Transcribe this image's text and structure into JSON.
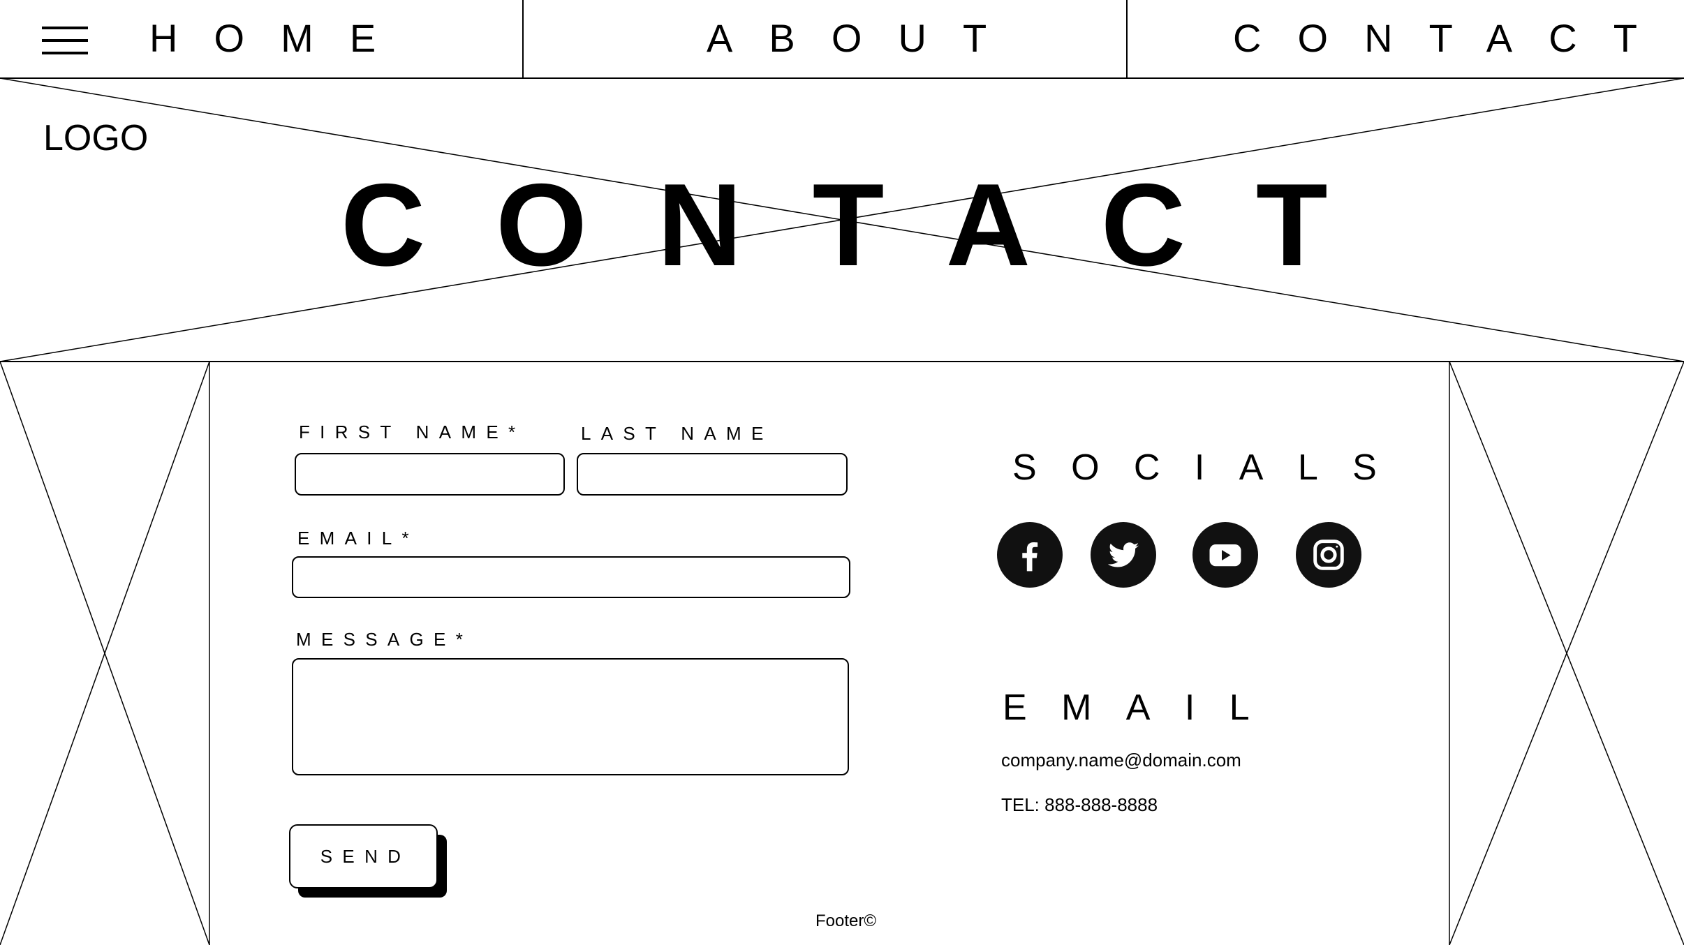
{
  "nav": {
    "menu_icon": "hamburger-icon",
    "links": [
      "HOME",
      "ABOUT",
      "CONTACT"
    ]
  },
  "header": {
    "logo": "LOGO",
    "title": "CONTACT"
  },
  "form": {
    "first_name_label": "FIRST NAME*",
    "last_name_label": "LAST NAME",
    "email_label": "EMAIL*",
    "message_label": "MESSAGE*",
    "first_name_value": "",
    "last_name_value": "",
    "email_value": "",
    "message_value": "",
    "send_label": "SEND"
  },
  "socials": {
    "heading": "SOCIALS",
    "icons": [
      "facebook-icon",
      "twitter-icon",
      "youtube-icon",
      "instagram-icon"
    ]
  },
  "contact_info": {
    "heading": "EMAIL",
    "email": "company.name@domain.com",
    "tel": "TEL: 888-888-8888"
  },
  "footer": {
    "text": "Footer©"
  }
}
